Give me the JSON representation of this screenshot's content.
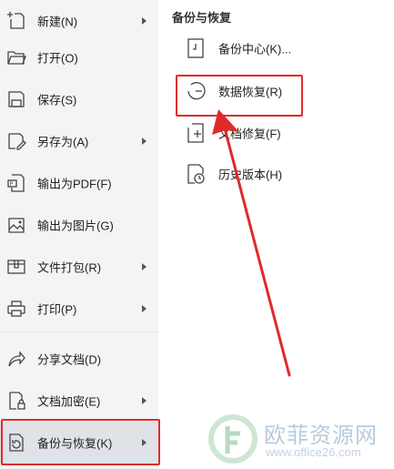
{
  "menu": {
    "items": [
      {
        "label": "新建(N)",
        "icon": "plus-doc-icon",
        "has_submenu": true
      },
      {
        "label": "打开(O)",
        "icon": "folder-icon",
        "has_submenu": false
      },
      {
        "label": "保存(S)",
        "icon": "save-icon",
        "has_submenu": false
      },
      {
        "label": "另存为(A)",
        "icon": "save-as-icon",
        "has_submenu": true
      },
      {
        "label": "输出为PDF(F)",
        "icon": "pdf-icon",
        "has_submenu": false
      },
      {
        "label": "输出为图片(G)",
        "icon": "image-icon",
        "has_submenu": false
      },
      {
        "label": "文件打包(R)",
        "icon": "package-icon",
        "has_submenu": true
      },
      {
        "label": "打印(P)",
        "icon": "printer-icon",
        "has_submenu": true
      },
      {
        "label": "分享文档(D)",
        "icon": "share-icon",
        "has_submenu": false
      },
      {
        "label": "文档加密(E)",
        "icon": "lock-doc-icon",
        "has_submenu": true
      },
      {
        "label": "备份与恢复(K)",
        "icon": "backup-icon",
        "has_submenu": true,
        "selected": true
      }
    ]
  },
  "submenu": {
    "title": "备份与恢复",
    "items": [
      {
        "label": "备份中心(K)...",
        "icon": "backup-center-icon"
      },
      {
        "label": "数据恢复(R)",
        "icon": "data-recovery-icon",
        "highlighted": true
      },
      {
        "label": "文档修复(F)",
        "icon": "doc-repair-icon"
      },
      {
        "label": "历史版本(H)",
        "icon": "history-version-icon"
      }
    ]
  },
  "annotation": {
    "color": "#e02a2a"
  },
  "watermark": {
    "text": "欧菲资源网",
    "url": "www.office26.com"
  }
}
